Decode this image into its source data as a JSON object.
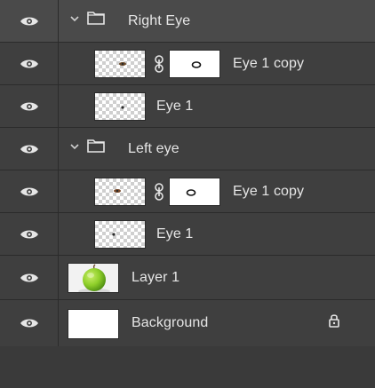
{
  "layers": [
    {
      "name": "Right Eye",
      "kind": "group",
      "selected": true
    },
    {
      "name": "Eye 1 copy",
      "kind": "layer-with-mask"
    },
    {
      "name": "Eye 1",
      "kind": "layer"
    },
    {
      "name": "Left eye",
      "kind": "group"
    },
    {
      "name": "Eye 1 copy",
      "kind": "layer-with-mask"
    },
    {
      "name": "Eye 1",
      "kind": "layer"
    },
    {
      "name": "Layer 1",
      "kind": "image-layer"
    },
    {
      "name": "Background",
      "kind": "background",
      "locked": true
    }
  ],
  "icons": {
    "visibility": "eye-icon",
    "group_expanded": "chevron-down-icon",
    "folder": "folder-icon",
    "link": "link-icon",
    "lock": "lock-icon"
  },
  "colors": {
    "panel_bg": "#3f3f3f",
    "selected_bg": "#4a4a4a",
    "text": "#e6e6e6"
  }
}
